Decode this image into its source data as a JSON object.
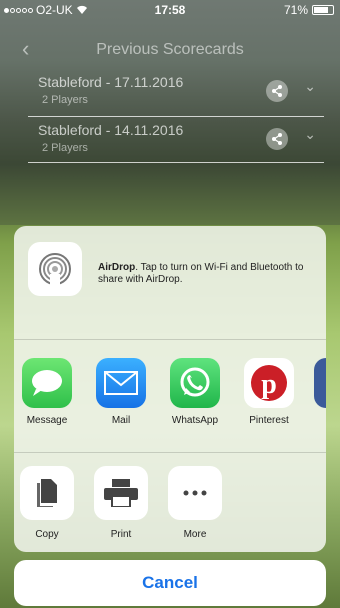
{
  "status_bar": {
    "carrier": "O2-UK",
    "time": "17:58",
    "battery": "71%"
  },
  "nav": {
    "title": "Previous Scorecards"
  },
  "scorecards": [
    {
      "title": "Stableford - 17.11.2016",
      "players": "2 Players"
    },
    {
      "title": "Stableford - 14.11.2016",
      "players": "2 Players"
    }
  ],
  "airdrop": {
    "title": "AirDrop",
    "text": ". Tap to turn on Wi-Fi and Bluetooth to share with AirDrop."
  },
  "apps": [
    {
      "label": "Message",
      "color": "#4cd964"
    },
    {
      "label": "Mail",
      "color": "#1d8cf0"
    },
    {
      "label": "WhatsApp",
      "color": "#25d366"
    },
    {
      "label": "Pinterest",
      "color": "#ffffff"
    }
  ],
  "actions": [
    {
      "label": "Copy"
    },
    {
      "label": "Print"
    },
    {
      "label": "More"
    }
  ],
  "cancel_label": "Cancel"
}
